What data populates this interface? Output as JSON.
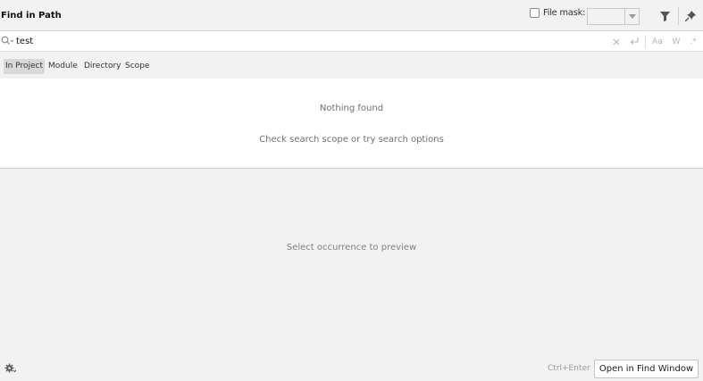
{
  "header": {
    "title": "Find in Path",
    "file_mask_label": "File mask:",
    "file_mask_value": "",
    "file_mask_checked": false
  },
  "search": {
    "query": "test",
    "match_case_label": "Aa",
    "words_label": "W",
    "regex_label": ".*"
  },
  "scopes": [
    {
      "label": "In Project",
      "active": true
    },
    {
      "label": "Module",
      "active": false
    },
    {
      "label": "Directory",
      "active": false
    },
    {
      "label": "Scope",
      "active": false
    }
  ],
  "results": {
    "empty_title": "Nothing found",
    "empty_hint": "Check search scope or try search options"
  },
  "preview": {
    "message": "Select occurrence to preview"
  },
  "footer": {
    "shortcut": "Ctrl+Enter",
    "open_button": "Open in Find Window"
  }
}
